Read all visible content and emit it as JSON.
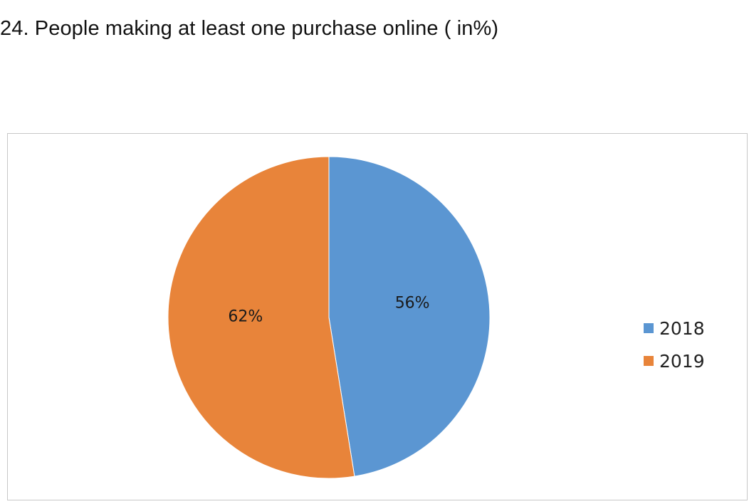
{
  "title": "24. People making at least one purchase online ( in%)",
  "chart_data": {
    "type": "pie",
    "title": "24. People making at least one purchase online ( in%)",
    "slices": [
      {
        "name": "2018",
        "value": 56,
        "label": "56%",
        "color": "#5b96d2"
      },
      {
        "name": "2019",
        "value": 62,
        "label": "62%",
        "color": "#e8843a"
      }
    ],
    "legend_position": "right"
  }
}
